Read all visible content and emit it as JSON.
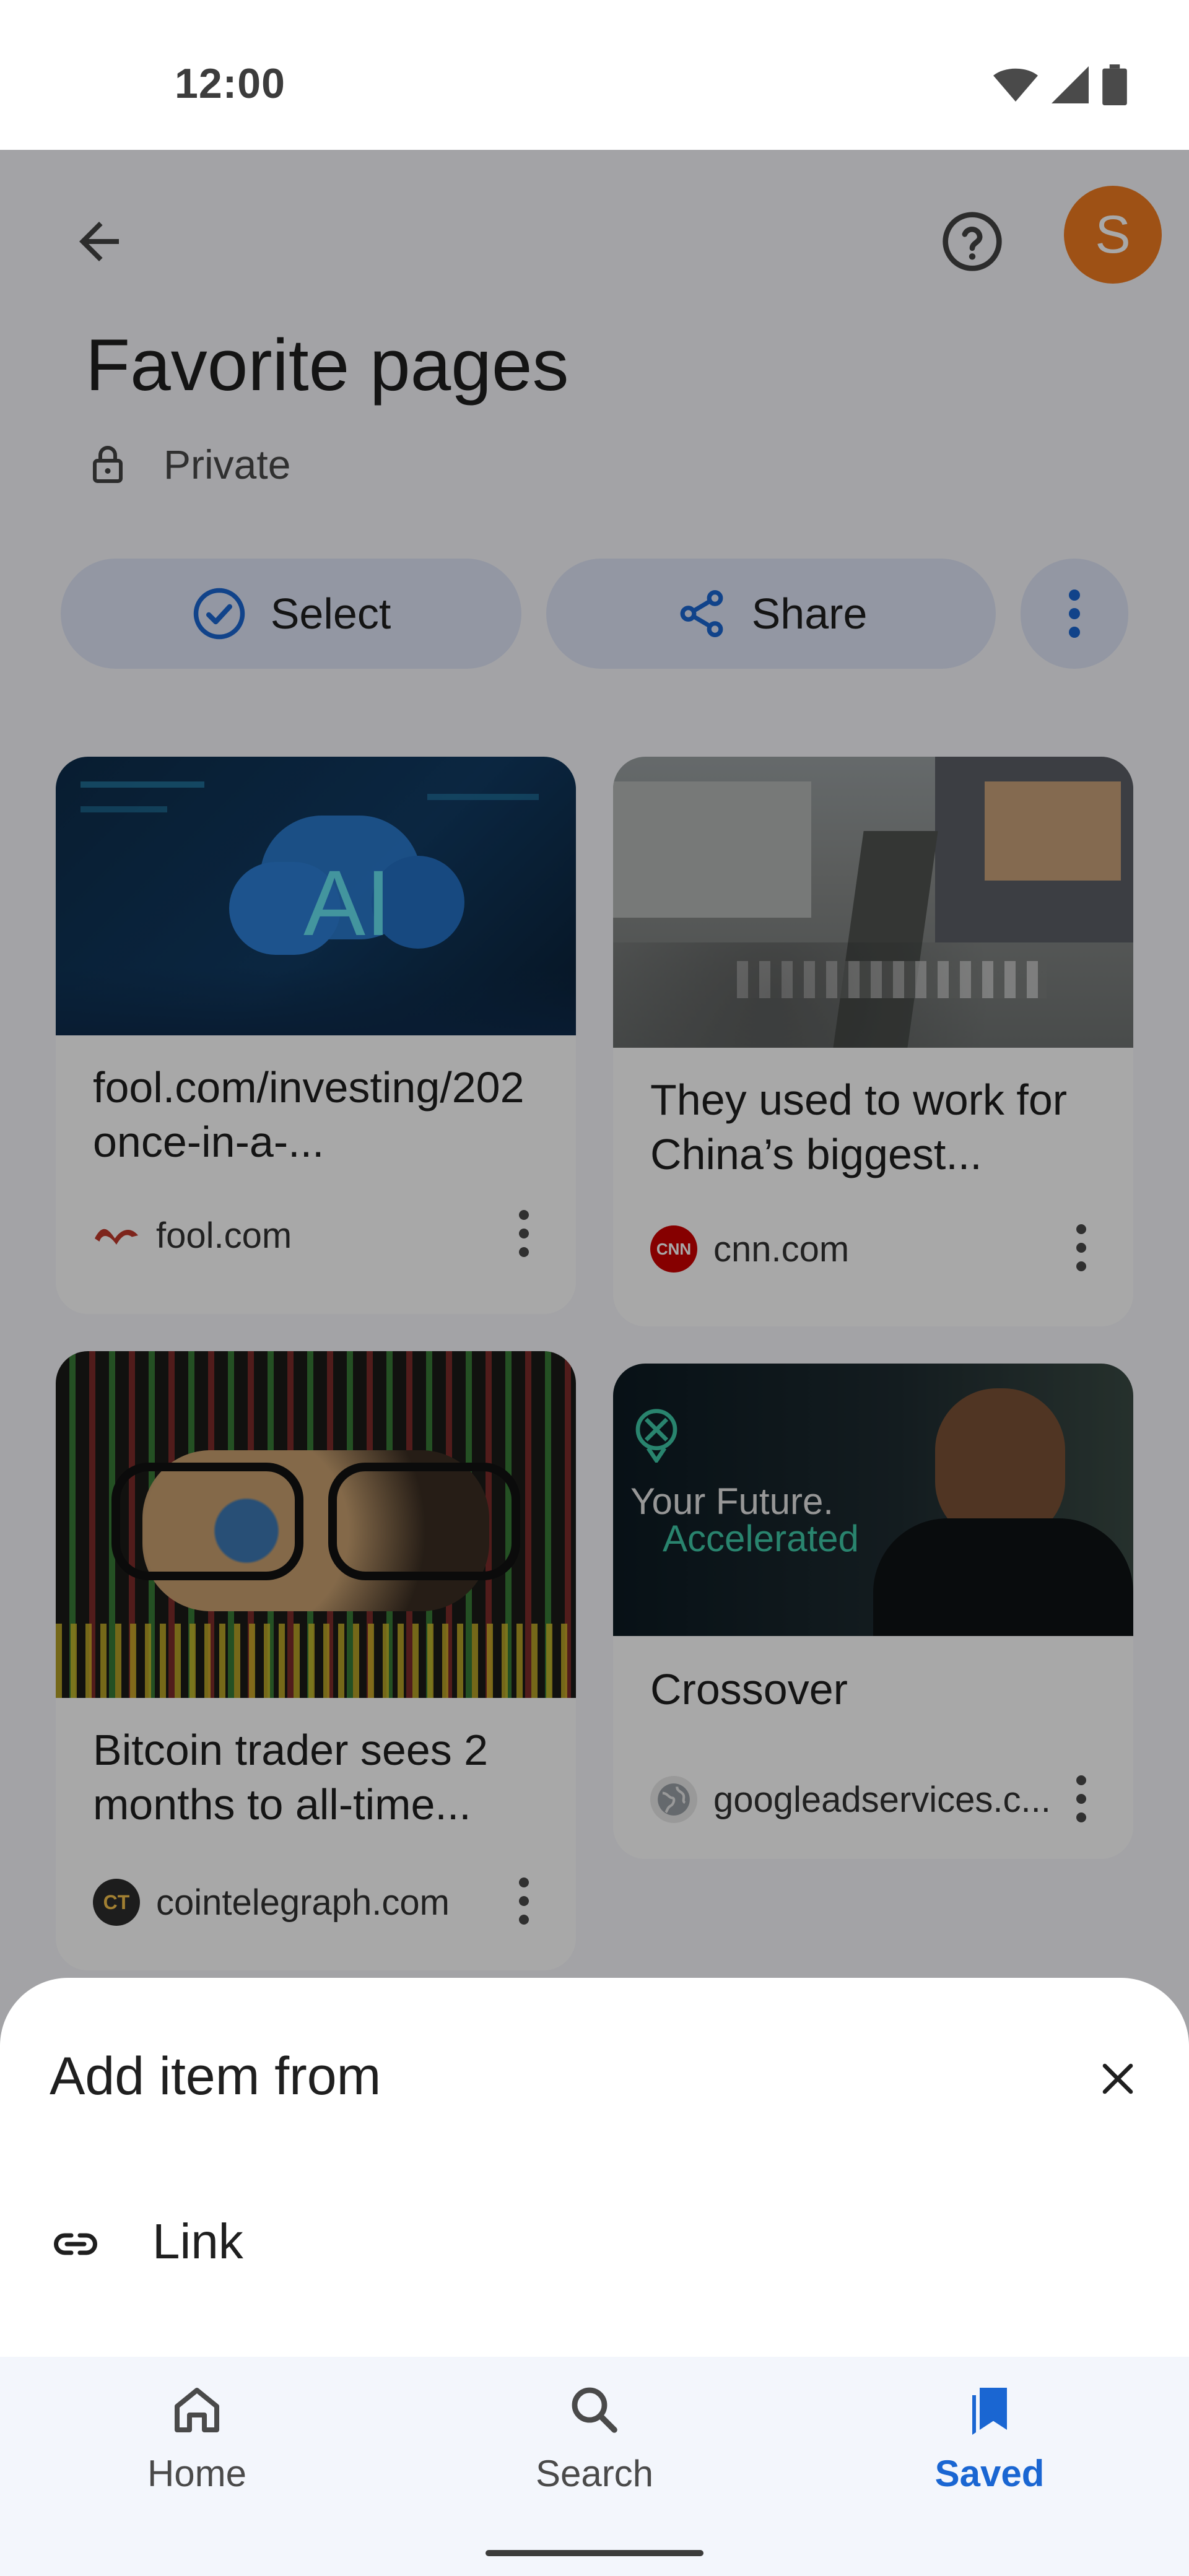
{
  "status": {
    "time": "12:00",
    "icons": [
      "wifi-icon",
      "signal-icon",
      "battery-icon"
    ]
  },
  "header": {
    "title": "Favorite pages",
    "privacy": "Private",
    "avatar_letter": "S"
  },
  "actions": {
    "select_label": "Select",
    "share_label": "Share"
  },
  "cards": [
    {
      "title": "fool.com/investing/202 once-in-a-...",
      "source": "fool.com",
      "image": "AI cloud over circuit board"
    },
    {
      "title": "They used to work for China’s biggest...",
      "source": "cnn.com",
      "image": "aerial view of busy street crossing"
    },
    {
      "title": "Bitcoin trader sees 2 months to all-time...",
      "source": "cointelegraph.com",
      "image": "eyes with glasses over crypto chart"
    },
    {
      "title": "Crossover",
      "source": "googleadservices.c...",
      "image": "man in dark shirt advert",
      "image_text_1": "Your Future.",
      "image_text_2": "Accelerated"
    }
  ],
  "sheet": {
    "title": "Add item from",
    "link_label": "Link"
  },
  "nav": {
    "home": "Home",
    "search": "Search",
    "saved": "Saved"
  },
  "colors": {
    "accent": "#1a66d2",
    "avatar": "#f07b21",
    "chip": "#dfe6f8"
  }
}
